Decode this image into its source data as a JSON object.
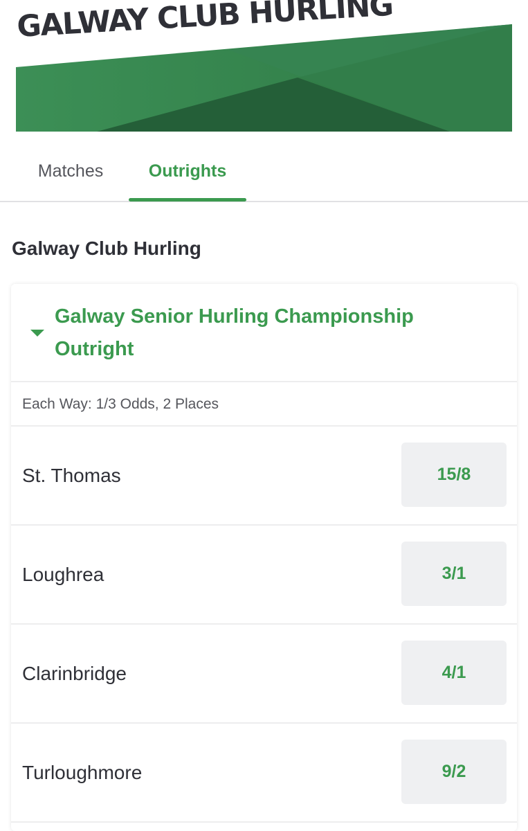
{
  "banner": {
    "title": "GALWAY CLUB HURLING",
    "colors": {
      "green_dark": "#1e5a32",
      "green_mid": "#2f7a45",
      "green_light": "#3c8f56",
      "title_text": "#2f3037"
    }
  },
  "tabs": [
    {
      "label": "Matches",
      "active": false
    },
    {
      "label": "Outrights",
      "active": true
    }
  ],
  "section": {
    "title": "Galway Club Hurling"
  },
  "market": {
    "title": "Galway Senior Hurling Championship Outright",
    "expanded": true,
    "caret_icon": "caret-down-icon",
    "each_way": "Each Way: 1/3 Odds, 2 Places",
    "selections": [
      {
        "name": "St. Thomas",
        "odds": "15/8"
      },
      {
        "name": "Loughrea",
        "odds": "3/1"
      },
      {
        "name": "Clarinbridge",
        "odds": "4/1"
      },
      {
        "name": "Turloughmore",
        "odds": "9/2"
      }
    ]
  },
  "colors": {
    "accent_green": "#3b9a4f",
    "text_dark": "#2f3037",
    "text_muted": "#55565c",
    "odds_button_bg": "#eff0f2",
    "divider": "#ededee"
  }
}
